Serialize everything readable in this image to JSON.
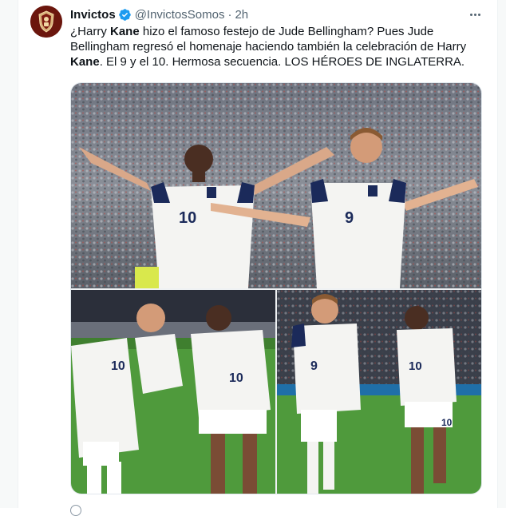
{
  "tweet": {
    "author": {
      "display_name": "Invictos",
      "handle": "@InvictosSomos",
      "verified": true,
      "avatar_icon": "team-crest-icon"
    },
    "separator": "·",
    "time": "2h",
    "text": {
      "segment_1": "¿Harry ",
      "segment_2": "Kane",
      "segment_3": " hizo el famoso festejo de Jude Bellingham? Pues Jude Bellingham regresó el homenaje haciendo también la celebración de Harry ",
      "segment_4": "Kane",
      "segment_5": ". El 9 y el 10. Hermosa secuencia. LOS HÉROES DE INGLATERRA."
    },
    "media": {
      "count": 3,
      "photos": [
        {
          "jersey_numbers": [
            "10",
            "9"
          ]
        },
        {
          "jersey_numbers": [
            "10",
            "10"
          ]
        },
        {
          "jersey_numbers": [
            "9",
            "10",
            "10"
          ]
        }
      ]
    }
  },
  "colors": {
    "text_primary": "#0f1419",
    "text_secondary": "#536471",
    "verified_blue": "#1d9bf0",
    "england_navy": "#1b2a5a",
    "pitch_green": "#4f9a3c"
  }
}
